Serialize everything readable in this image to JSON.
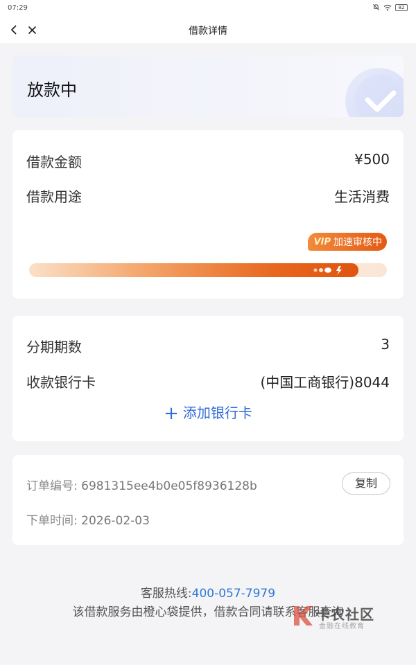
{
  "statusbar": {
    "time": "07:29",
    "battery": "82"
  },
  "navbar": {
    "title": "借款详情",
    "back_icon": "chevron-left-icon",
    "close_icon": "close-icon"
  },
  "status_card": {
    "title": "放款中",
    "icon": "check-circle-icon"
  },
  "loan_card": {
    "amount_label": "借款金额",
    "amount_value": "¥500",
    "purpose_label": "借款用途",
    "purpose_value": "生活消费",
    "badge_vip": "VIP",
    "badge_text": "加速审核中",
    "progress": 0.92,
    "progress_colors": {
      "start": "#fbe0c8",
      "end": "#df5410"
    }
  },
  "installment_card": {
    "periods_label": "分期期数",
    "periods_value": "3",
    "bank_label": "收款银行卡",
    "bank_value": "(中国工商银行)8044",
    "add_card_label": "添加银行卡"
  },
  "order_card": {
    "order_no_label": "订单编号:",
    "order_no_value": "6981315ee4b0e05f8936128b",
    "copy_label": "复制",
    "order_time_label": "下单时间:",
    "order_time_value": "2026-02-03"
  },
  "footer": {
    "hotline_label": "客服热线:",
    "hotline_value": "400-057-7979",
    "note": "该借款服务由橙心袋提供，借款合同请联系客服查询"
  },
  "watermark": {
    "title": "卡农社区",
    "subtitle": "金融在线教育"
  },
  "colors": {
    "accent_blue": "#2f6bd8",
    "accent_orange": "#e45a14",
    "background": "#f4f4f6"
  }
}
